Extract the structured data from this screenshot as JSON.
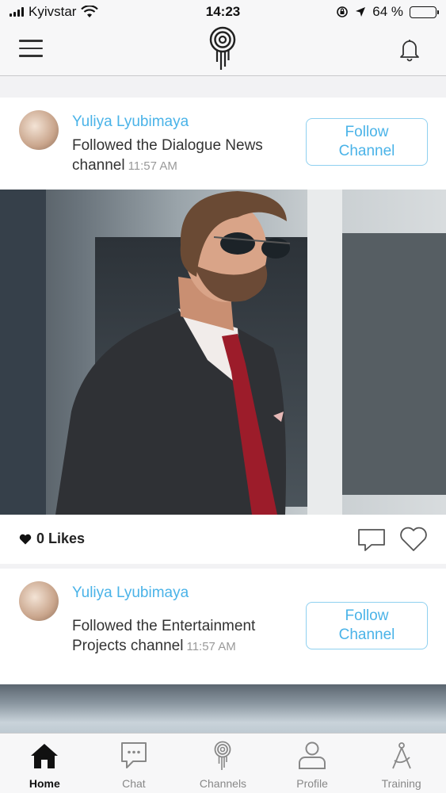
{
  "status_bar": {
    "carrier": "Kyivstar",
    "time": "14:23",
    "battery_text": "64 %",
    "battery_level": 0.64
  },
  "top_nav": {
    "menu_icon": "hamburger-menu-icon",
    "logo_icon": "app-logo-icon",
    "notifications_icon": "bell-icon"
  },
  "feed": [
    {
      "author": "Yuliya Lyubimaya",
      "activity": "Followed the Dialogue News channel",
      "time": "11:57 AM",
      "follow_label_line1": "Follow",
      "follow_label_line2": "Channel",
      "likes_text": "0 Likes"
    },
    {
      "author": "Yuliya Lyubimaya",
      "activity": "Followed the Entertainment Projects channel",
      "time": "11:57 AM",
      "follow_label_line1": "Follow",
      "follow_label_line2": "Channel"
    }
  ],
  "tab_bar": {
    "tabs": [
      {
        "label": "Home",
        "icon": "home-icon",
        "active": true
      },
      {
        "label": "Chat",
        "icon": "chat-icon",
        "active": false
      },
      {
        "label": "Channels",
        "icon": "channels-icon",
        "active": false
      },
      {
        "label": "Profile",
        "icon": "profile-icon",
        "active": false
      },
      {
        "label": "Training",
        "icon": "compass-icon",
        "active": false
      }
    ]
  },
  "colors": {
    "accent": "#4ab3e8",
    "follow_border": "#8fd0f0",
    "bar_background": "#f7f7f8"
  }
}
